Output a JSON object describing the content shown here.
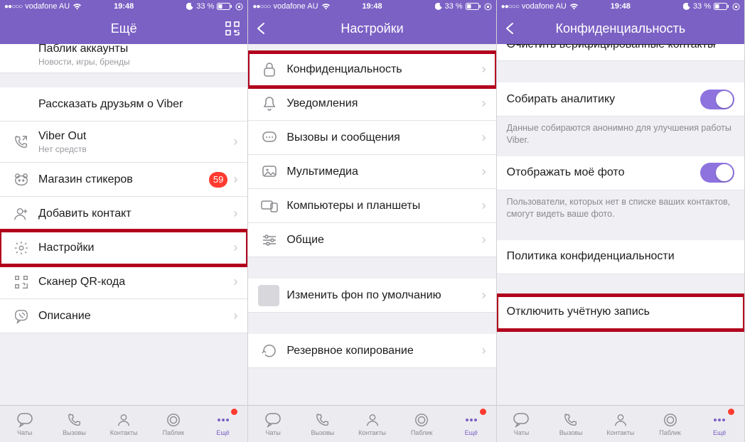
{
  "status": {
    "carrier": "vodafone AU",
    "time": "19:48",
    "battery_pct": "33 %",
    "signal_dots": "●●○○○"
  },
  "screen1": {
    "title": "Ещё",
    "cutoff_title": "Паблик аккаунты",
    "cutoff_sub": "Новости, игры, бренды",
    "rows": {
      "tell_friends": "Рассказать друзьям о Viber",
      "viber_out": "Viber Out",
      "viber_out_sub": "Нет средств",
      "stickers": "Магазин стикеров",
      "stickers_badge": "59",
      "add_contact": "Добавить контакт",
      "settings": "Настройки",
      "qr_scanner": "Сканер QR-кода",
      "about": "Описание"
    }
  },
  "screen2": {
    "title": "Настройки",
    "rows": {
      "privacy": "Конфиденциальность",
      "notifications": "Уведомления",
      "calls_msgs": "Вызовы и сообщения",
      "media": "Мультимедиа",
      "computers": "Компьютеры и планшеты",
      "general": "Общие",
      "wallpaper": "Изменить фон по умолчанию",
      "backup": "Резервное копирование"
    }
  },
  "screen3": {
    "title": "Конфиденциальность",
    "cutoff_row": "Очистить верифицированные контакты",
    "rows": {
      "analytics": "Собирать аналитику",
      "analytics_note": "Данные собираются анонимно для улучшения работы Viber.",
      "show_photo": "Отображать моё фото",
      "show_photo_note": "Пользователи, которых нет в списке ваших контактов, смогут видеть ваше фото.",
      "privacy_policy": "Политика конфиденциальности",
      "deactivate": "Отключить учётную запись"
    }
  },
  "tabs": {
    "chats": "Чаты",
    "calls": "Вызовы",
    "contacts": "Контакты",
    "public": "Паблик",
    "more": "Ещё"
  }
}
